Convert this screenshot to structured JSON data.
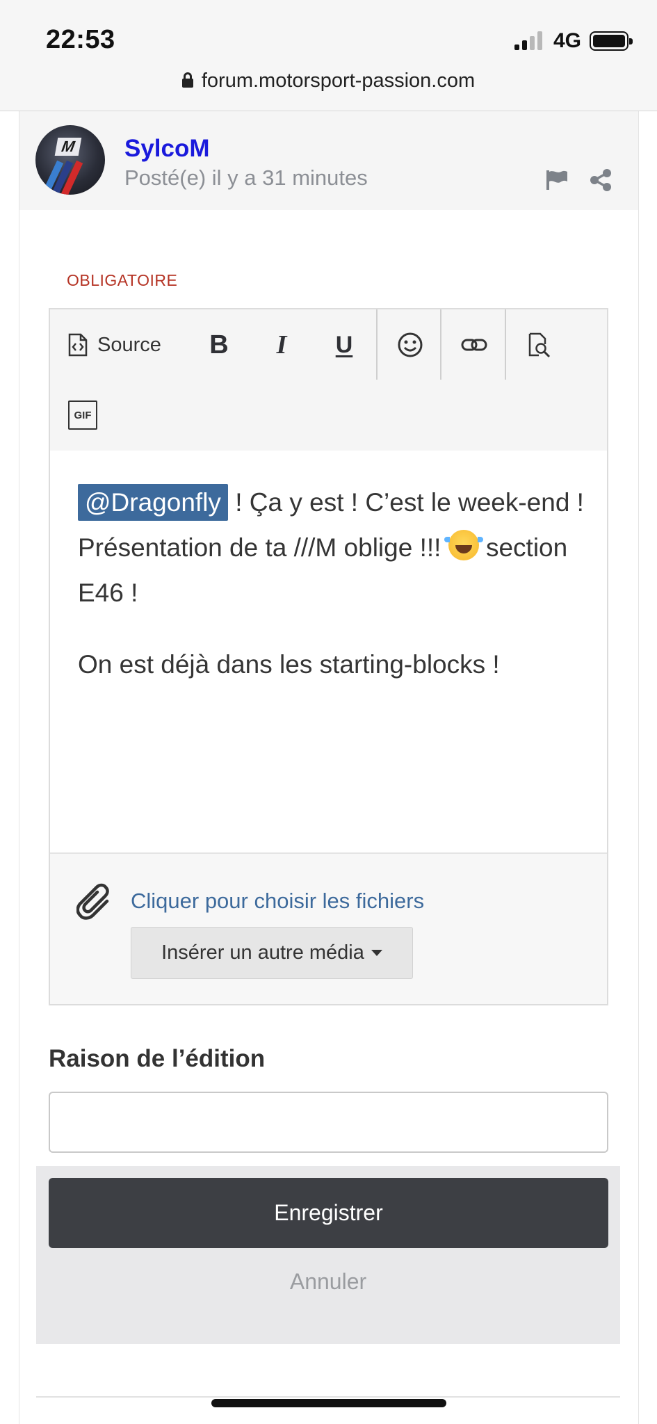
{
  "status_bar": {
    "time": "22:53",
    "network": "4G"
  },
  "browser": {
    "url": "forum.motorsport-passion.com"
  },
  "post": {
    "username": "SylcoM",
    "posted": "Posté(e) il y a 31 minutes"
  },
  "editor": {
    "required_label": "OBLIGATOIRE",
    "toolbar": {
      "source_label": "Source",
      "bold_label": "B",
      "italic_label": "I",
      "underline_label": "U",
      "gif_label": "GIF"
    },
    "content": {
      "mention": "@Dragonfly",
      "para1_text": " ! Ça y est ! C’est le week-end ! Présentation de ta ///M oblige !!! ",
      "para1_tail": " section E46 !",
      "para2": "On est déjà dans les starting-blocks !"
    },
    "attach": {
      "link_label": "Cliquer pour choisir les fichiers",
      "media_button_label": "Insérer un autre média"
    }
  },
  "edit_reason": {
    "label": "Raison de l’édition",
    "value": ""
  },
  "actions": {
    "save_label": "Enregistrer",
    "cancel_label": "Annuler"
  },
  "colors": {
    "username": "#1a1adc",
    "mention_bg": "#3d6a9c",
    "required": "#b53324",
    "save_bg": "#3d3f44"
  }
}
